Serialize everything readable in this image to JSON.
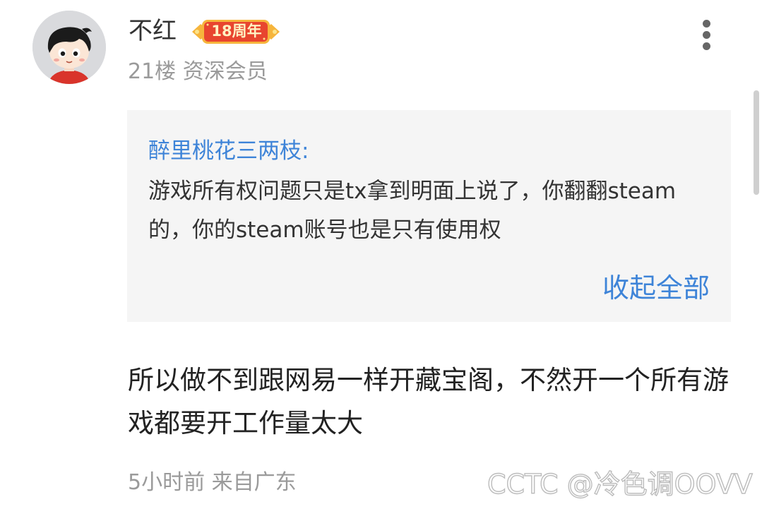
{
  "comment": {
    "username": "不红",
    "badge": {
      "label": "18周年",
      "colors": {
        "background": "#e8452f",
        "accent": "#f6b53c"
      },
      "icon": "anniversary-badge"
    },
    "meta": "21楼 资深会员",
    "more_icon": "more-vertical-icon",
    "quote": {
      "author": "醉里桃花三两枝:",
      "text": "游戏所有权问题只是tx拿到明面上说了，你翻翻steam的，你的steam账号也是只有使用权",
      "collapse_label": "收起全部"
    },
    "body": "所以做不到跟网易一样开藏宝阁，不然开一个所有游戏都要开工作量太大",
    "footer": "5小时前 来自广东",
    "watermark": "CCTC @冷色调OOVV"
  },
  "colors": {
    "link": "#3e84d8",
    "muted": "#9a9a9a",
    "quote_background": "#f5f5f5",
    "text": "#222222"
  }
}
